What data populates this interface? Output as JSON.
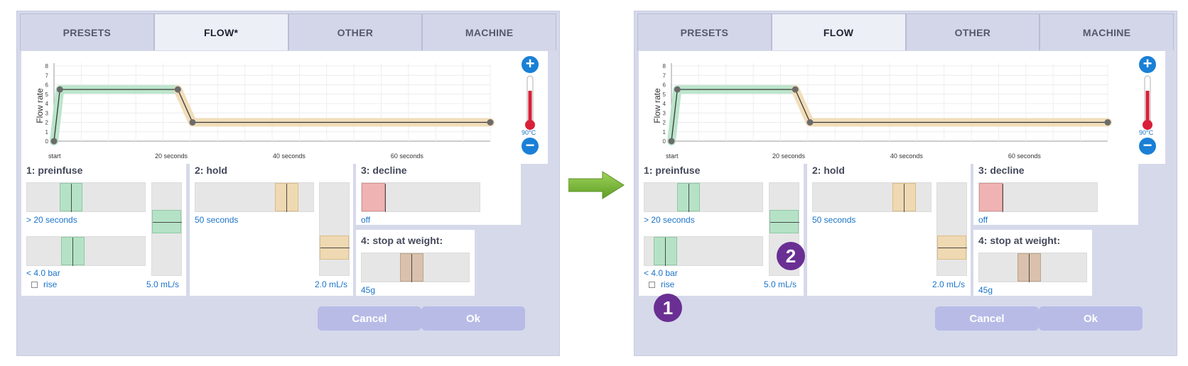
{
  "colors": {
    "preinfuse": "#b5e2c6",
    "hold": "#efd9b2",
    "decline": "#f0b3b3",
    "weight": "#d9c1ad",
    "accent": "#1a80d6",
    "badge": "#6a2f93"
  },
  "screens": [
    {
      "tabs": [
        "PRESETS",
        "FLOW*",
        "OTHER",
        "MACHINE"
      ],
      "active_tab": 1,
      "chart": {
        "ylabel": "Flow rate",
        "yticks": [
          "0",
          "1",
          "2",
          "3",
          "4",
          "5",
          "6",
          "7",
          "8"
        ],
        "xticks": [
          "start",
          "20 seconds",
          "40 seconds",
          "60 seconds"
        ],
        "temperature": "90°C"
      },
      "preinfuse": {
        "title": "1: preinfuse",
        "time": "> 20 seconds",
        "pressure": "< 4.0 bar",
        "rise": "rise",
        "flow": "5.0 mL/s"
      },
      "hold": {
        "title": "2: hold",
        "time": "50 seconds",
        "flow": "2.0 mL/s"
      },
      "decline": {
        "title": "3: decline",
        "value": "off"
      },
      "weight": {
        "title": "4: stop at weight:",
        "value": "45g"
      },
      "buttons": {
        "cancel": "Cancel",
        "ok": "Ok"
      }
    },
    {
      "tabs": [
        "PRESETS",
        "FLOW",
        "OTHER",
        "MACHINE"
      ],
      "active_tab": 1,
      "chart": {
        "ylabel": "Flow rate",
        "yticks": [
          "0",
          "1",
          "2",
          "3",
          "4",
          "5",
          "6",
          "7",
          "8"
        ],
        "xticks": [
          "start",
          "20 seconds",
          "40 seconds",
          "60 seconds"
        ],
        "temperature": "90°C"
      },
      "preinfuse": {
        "title": "1: preinfuse",
        "time": "> 20 seconds",
        "pressure": "< 4.0 bar",
        "rise": "rise",
        "flow": "5.0 mL/s"
      },
      "hold": {
        "title": "2: hold",
        "time": "50 seconds",
        "flow": "2.0 mL/s"
      },
      "decline": {
        "title": "3: decline",
        "value": "off"
      },
      "weight": {
        "title": "4: stop at weight:",
        "value": "45g"
      },
      "buttons": {
        "cancel": "Cancel",
        "ok": "Ok"
      }
    }
  ],
  "callouts": [
    "1",
    "2"
  ],
  "chart_data": {
    "type": "line",
    "ylabel": "Flow rate",
    "ylim": [
      0,
      8
    ],
    "xticks": [
      "start",
      "20 seconds",
      "40 seconds",
      "60 seconds"
    ],
    "series": [
      {
        "x": [
          0,
          1,
          21,
          23.5,
          74
        ],
        "y": [
          0,
          5.5,
          5.5,
          2,
          2
        ]
      }
    ]
  }
}
